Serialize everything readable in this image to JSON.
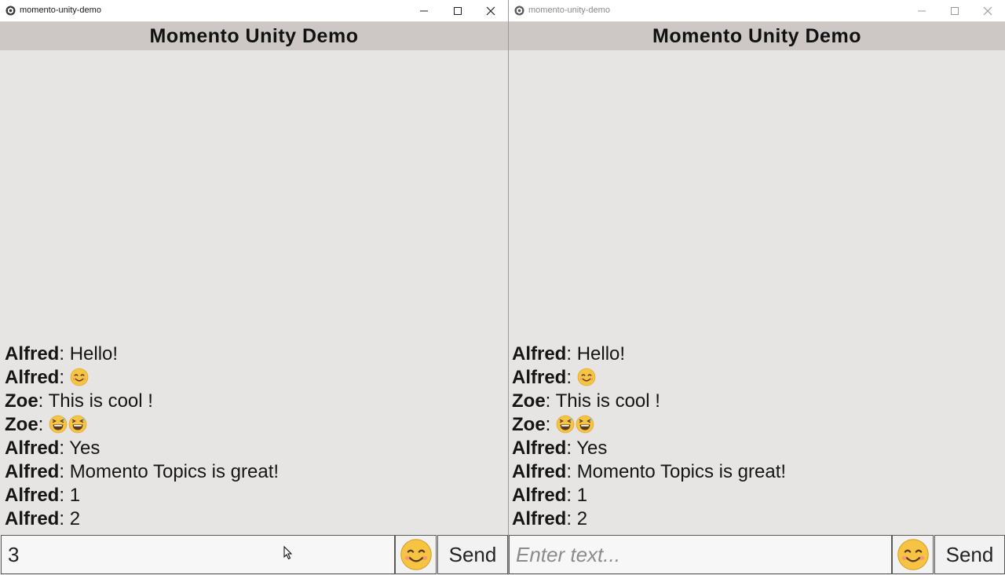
{
  "windows": [
    {
      "id": "left",
      "title": "momento-unity-demo",
      "header": "Momento Unity Demo",
      "messages": [
        {
          "user": "Alfred",
          "text": "Hello!"
        },
        {
          "user": "Alfred",
          "emoji": [
            "smiling-face-icon"
          ]
        },
        {
          "user": "Zoe",
          "text": "This is cool !"
        },
        {
          "user": "Zoe",
          "emoji": [
            "grinning-sweat-face-icon",
            "grinning-sweat-face-icon"
          ]
        },
        {
          "user": "Alfred",
          "text": "Yes"
        },
        {
          "user": "Alfred",
          "text": "Momento Topics is great!"
        },
        {
          "user": "Alfred",
          "text": "1"
        },
        {
          "user": "Alfred",
          "text": "2"
        }
      ],
      "input_value": "3",
      "input_placeholder": "Enter text...",
      "send_label": "Send"
    },
    {
      "id": "right",
      "title": "momento-unity-demo",
      "header": "Momento Unity Demo",
      "messages": [
        {
          "user": "Alfred",
          "text": "Hello!"
        },
        {
          "user": "Alfred",
          "emoji": [
            "smiling-face-icon"
          ]
        },
        {
          "user": "Zoe",
          "text": "This is cool !"
        },
        {
          "user": "Zoe",
          "emoji": [
            "grinning-sweat-face-icon",
            "grinning-sweat-face-icon"
          ]
        },
        {
          "user": "Alfred",
          "text": "Yes"
        },
        {
          "user": "Alfred",
          "text": "Momento Topics is great!"
        },
        {
          "user": "Alfred",
          "text": "1"
        },
        {
          "user": "Alfred",
          "text": "2"
        }
      ],
      "input_value": "",
      "input_placeholder": "Enter text...",
      "send_label": "Send"
    }
  ],
  "colors": {
    "header_bg": "#cdc7c5",
    "chat_bg": "#e6e5e3",
    "titlebar_bg": "#ffffff",
    "emoji_yellow": "#f6c342"
  }
}
